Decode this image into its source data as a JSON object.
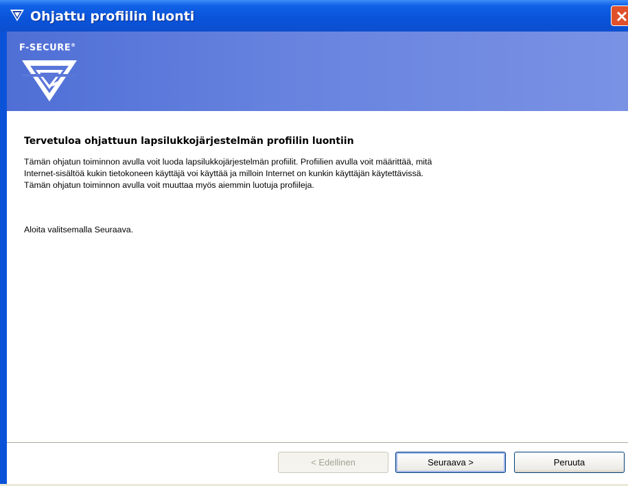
{
  "window": {
    "title": "Ohjattu profiilin luonti",
    "icon": "f-secure-shield-icon",
    "close_icon": "close-icon"
  },
  "banner": {
    "brand": "F-SECURE",
    "brand_mark": "®",
    "logo_icon": "f-secure-logo-icon"
  },
  "content": {
    "heading": "Tervetuloa ohjattuun lapsilukkojärjestelmän profiilin luontiin",
    "paragraph_lines": [
      "Tämän ohjatun toiminnon avulla voit luoda lapsilukkojärjestelmän profiilit. Profiilien avulla voit määrittää, mitä",
      "Internet-sisältöä kukin tietokoneen käyttäjä voi käyttää ja milloin Internet on kunkin käyttäjän käytettävissä.",
      "Tämän ohjatun toiminnon avulla voit muuttaa myös aiemmin luotuja profiileja."
    ],
    "start_text": "Aloita valitsemalla Seuraava."
  },
  "buttons": {
    "prev": "< Edellinen",
    "next": "Seuraava >",
    "cancel": "Peruuta"
  },
  "colors": {
    "titlebar": "#0a53d9",
    "banner": "#6783df",
    "close": "#e0512b"
  }
}
